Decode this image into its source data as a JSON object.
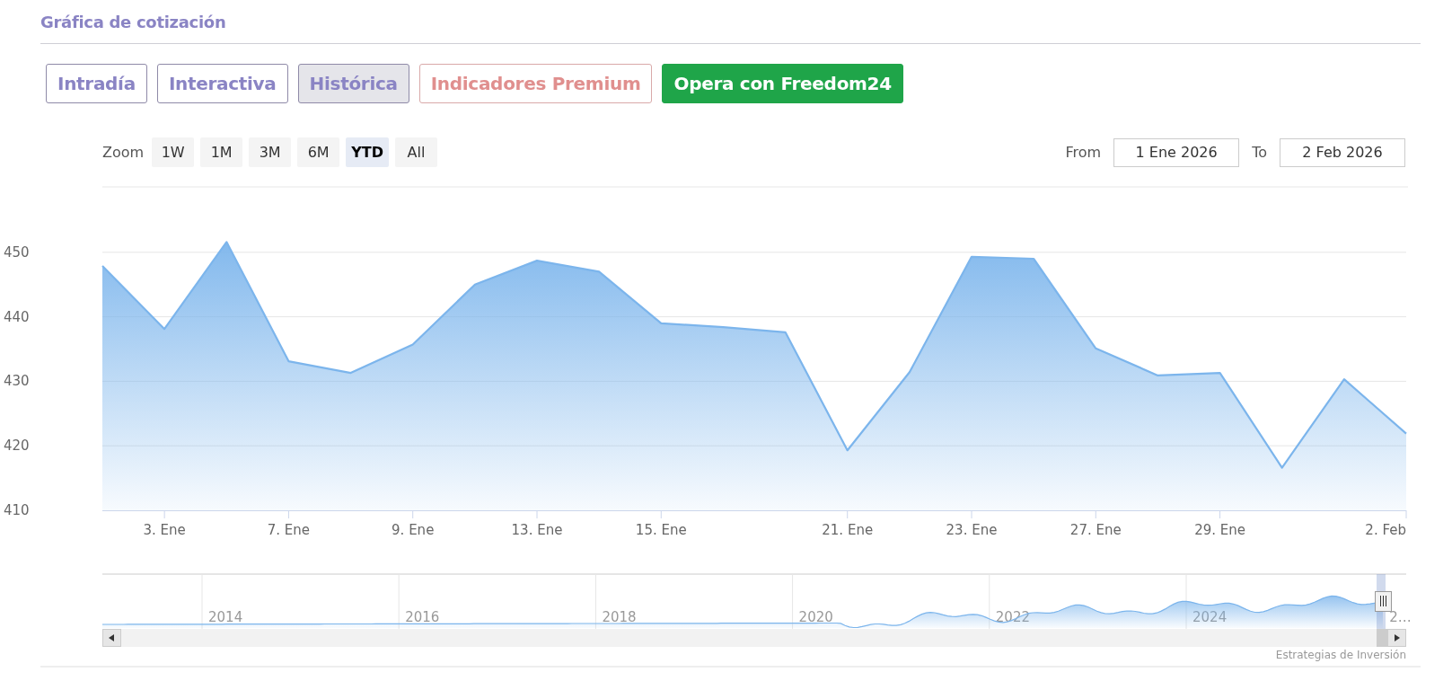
{
  "section_title": "Gráfica de cotización",
  "buttons": [
    {
      "label": "Intradía",
      "kind": "tab",
      "selected": false
    },
    {
      "label": "Interactiva",
      "kind": "tab",
      "selected": false
    },
    {
      "label": "Histórica",
      "kind": "tab",
      "selected": true
    },
    {
      "label": "Indicadores Premium",
      "kind": "premium",
      "selected": false
    },
    {
      "label": "Opera con Freedom24",
      "kind": "cta",
      "selected": false
    }
  ],
  "range_selector": {
    "label": "Zoom",
    "buttons": [
      {
        "label": "1W",
        "selected": false
      },
      {
        "label": "1M",
        "selected": false
      },
      {
        "label": "3M",
        "selected": false
      },
      {
        "label": "6M",
        "selected": false
      },
      {
        "label": "YTD",
        "selected": true
      },
      {
        "label": "All",
        "selected": false
      }
    ],
    "from_label": "From",
    "from_value": "1 Ene 2026",
    "to_label": "To",
    "to_value": "2 Feb 2026"
  },
  "chart": {
    "chart_data": {
      "type": "area",
      "categories": [
        null,
        "3. Ene",
        null,
        "7. Ene",
        null,
        "9. Ene",
        null,
        "13. Ene",
        null,
        "15. Ene",
        null,
        null,
        "21. Ene",
        null,
        "23. Ene",
        null,
        "27. Ene",
        null,
        "29. Ene",
        null,
        null,
        "2. Feb"
      ],
      "series": [
        {
          "color": "#7cb5ec",
          "values": [
            447.9,
            438.1,
            451.6,
            433.1,
            431.3,
            435.7,
            445.0,
            448.7,
            447.0,
            439.0,
            438.4,
            437.6,
            419.3,
            431.4,
            449.3,
            449.0,
            435.1,
            430.9,
            431.3,
            416.6,
            430.3,
            421.9
          ]
        }
      ],
      "grid": true,
      "ylim": [
        410,
        460
      ],
      "yticks": [
        410,
        420,
        430,
        440,
        450
      ]
    }
  },
  "navigator": {
    "labels": [
      "2014",
      "2016",
      "2018",
      "2020",
      "2022",
      "2024",
      "2…"
    ]
  },
  "credits": "Estrategias de Inversión"
}
